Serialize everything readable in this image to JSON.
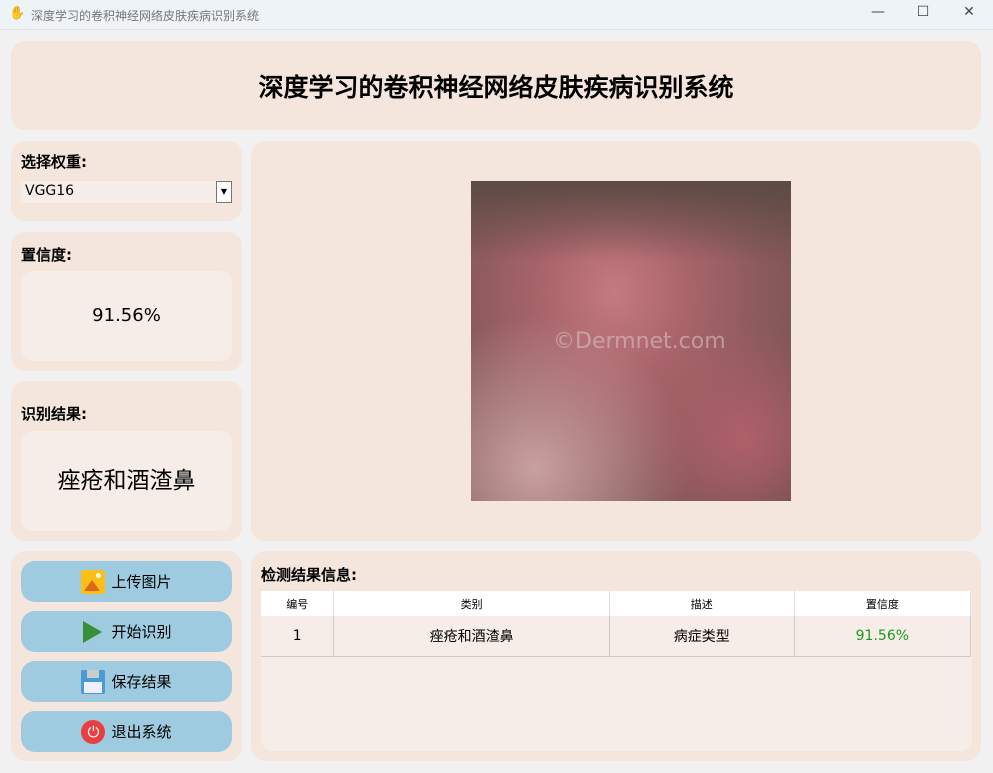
{
  "window": {
    "title": "深度学习的卷积神经网络皮肤疾病识别系统"
  },
  "header": {
    "title": "深度学习的卷积神经网络皮肤疾病识别系统"
  },
  "weights": {
    "label": "选择权重:",
    "selected": "VGG16"
  },
  "confidence": {
    "label": "置信度:",
    "value": "91.56%"
  },
  "result": {
    "label": "识别结果:",
    "value": "痤疮和酒渣鼻"
  },
  "image": {
    "watermark": "©Dermnet.com"
  },
  "buttons": {
    "upload": "上传图片",
    "start": "开始识别",
    "save": "保存结果",
    "exit": "退出系统"
  },
  "table": {
    "title": "检测结果信息:",
    "headers": [
      "编号",
      "类别",
      "描述",
      "置信度"
    ],
    "rows": [
      {
        "id": "1",
        "category": "痤疮和酒渣鼻",
        "desc": "病症类型",
        "conf": "91.56%"
      }
    ]
  },
  "colors": {
    "confidence_text": "#1a9a1a"
  }
}
